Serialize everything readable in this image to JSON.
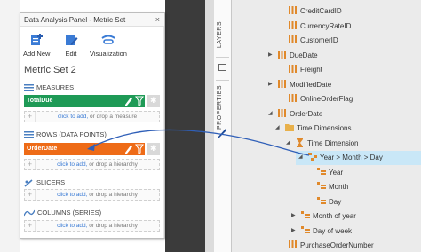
{
  "panel": {
    "title": "Data Analysis Panel - Metric Set",
    "close": "×",
    "toolbar": [
      {
        "label": "Add New",
        "icon": "add-new-icon"
      },
      {
        "label": "Edit",
        "icon": "edit-icon"
      },
      {
        "label": "Visualization",
        "icon": "visualization-icon"
      }
    ],
    "metric_set_name": "Metric Set 2",
    "sections": {
      "measures": {
        "label": "MEASURES",
        "item": "TotalDue",
        "color": "#1e9a56",
        "drop_link": "click to add,",
        "drop_text": " or drop a measure"
      },
      "rows": {
        "label": "ROWS (DATA POINTS)",
        "item": "OrderDate",
        "color": "#ee6b17",
        "drop_link": "click to add,",
        "drop_text": " or drop a hierarchy"
      },
      "slicers": {
        "label": "SLICERS",
        "drop_link": "click to add,",
        "drop_text": " or drop a hierarchy"
      },
      "columns": {
        "label": "COLUMNS (SERIES)",
        "drop_link": "click to add,",
        "drop_text": " or drop a hierarchy"
      }
    }
  },
  "side_tabs": [
    "LAYERS",
    "PROPERTIES"
  ],
  "tree": {
    "items": [
      {
        "label": "CreditCardID",
        "icon": "column-icon"
      },
      {
        "label": "CurrencyRateID",
        "icon": "column-icon"
      },
      {
        "label": "CustomerID",
        "icon": "column-icon"
      },
      {
        "label": "DueDate",
        "icon": "column-icon",
        "expander": "collapsed"
      },
      {
        "label": "Freight",
        "icon": "column-icon"
      },
      {
        "label": "ModifiedDate",
        "icon": "column-icon",
        "expander": "collapsed"
      },
      {
        "label": "OnlineOrderFlag",
        "icon": "column-icon"
      },
      {
        "label": "OrderDate",
        "icon": "column-icon",
        "expander": "expanded"
      },
      {
        "label": "Time Dimensions",
        "icon": "folder-icon",
        "expander": "expanded"
      },
      {
        "label": "Time Dimension",
        "icon": "time-dimension-icon",
        "expander": "expanded"
      },
      {
        "label": "Year > Month > Day",
        "icon": "hierarchy-icon",
        "expander": "expanded",
        "selected": true
      },
      {
        "label": "Year",
        "icon": "level-icon"
      },
      {
        "label": "Month",
        "icon": "level-icon"
      },
      {
        "label": "Day",
        "icon": "level-icon"
      },
      {
        "label": "Month of year",
        "icon": "level-icon",
        "expander": "collapsed"
      },
      {
        "label": "Day of week",
        "icon": "level-icon",
        "expander": "collapsed"
      },
      {
        "label": "PurchaseOrderNumber",
        "icon": "column-icon"
      }
    ]
  },
  "colors": {
    "selection": "#c9e7f7",
    "drag_arrow": "#2f5fb8",
    "accent_link": "#3a7bd5"
  }
}
